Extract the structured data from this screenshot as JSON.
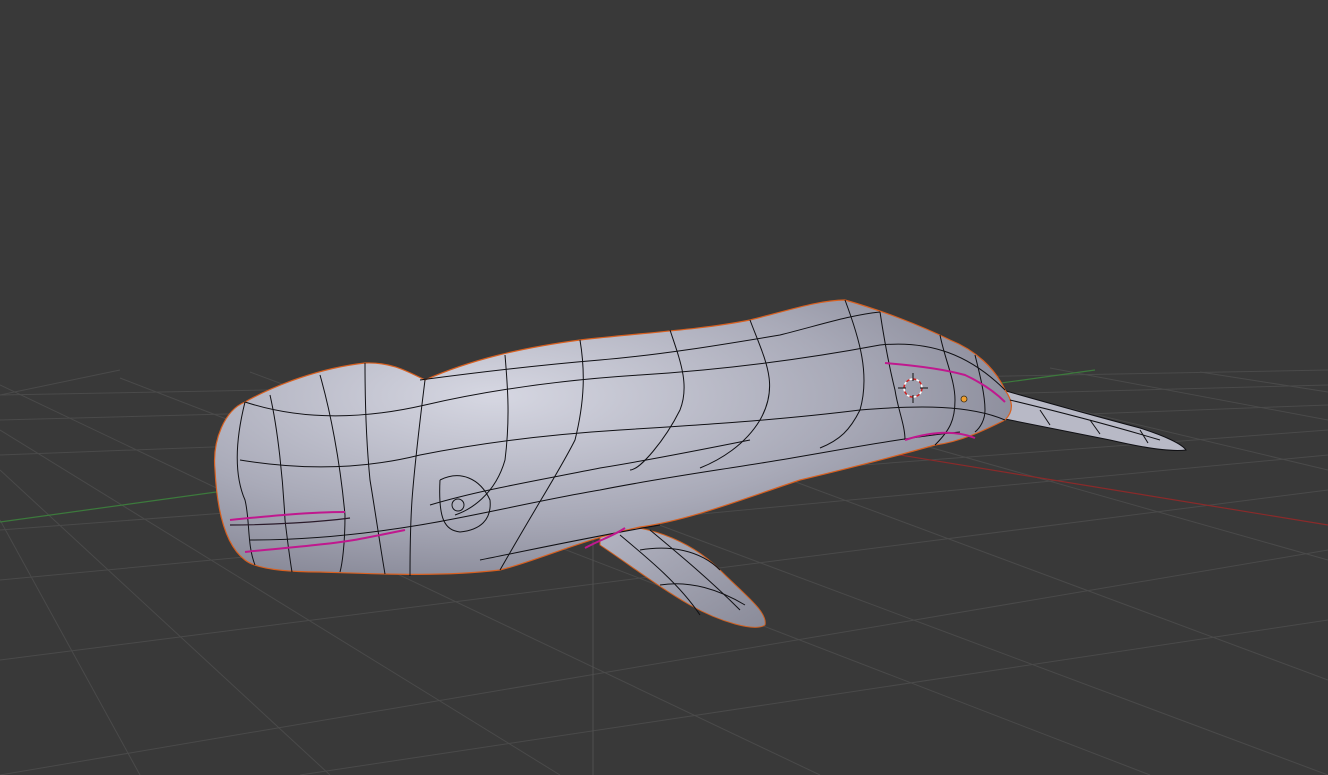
{
  "viewport": {
    "background_color": "#393939",
    "grid_color": "#4a4a4a",
    "x_axis_color": "#8a2a2a",
    "y_axis_color": "#3c7a3c",
    "mesh_fill_color": "#a7a8b6",
    "wire_color": "#101014",
    "seam_color": "#c0188e",
    "selection_outline_color": "#e07020",
    "origin_color": "#f0a030",
    "object_semantic": "whale-mesh",
    "cursor_icon": "3d-cursor-icon",
    "origin_icon": "object-origin-dot"
  }
}
